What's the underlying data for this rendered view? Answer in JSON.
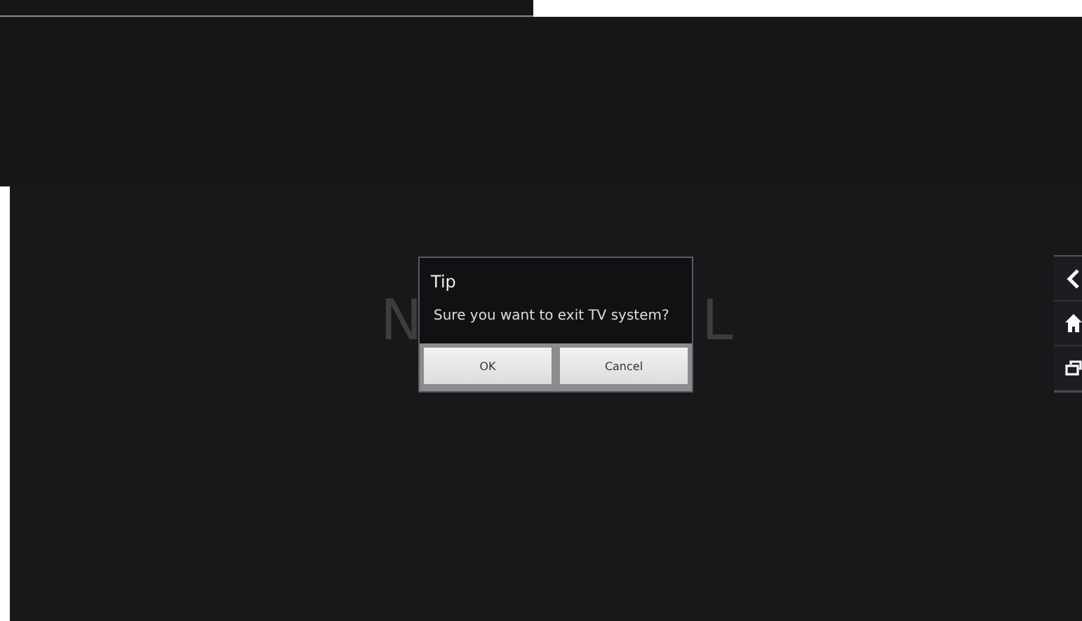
{
  "background_text": {
    "left_part": "N",
    "right_part": "L"
  },
  "dialog": {
    "title": "Tip",
    "message": "Sure you want to exit TV system?",
    "buttons": [
      "OK",
      "Cancel"
    ]
  },
  "nav_bar": {
    "buttons": [
      {
        "kind": "back"
      },
      {
        "kind": "home"
      },
      {
        "kind": "recent"
      }
    ]
  }
}
